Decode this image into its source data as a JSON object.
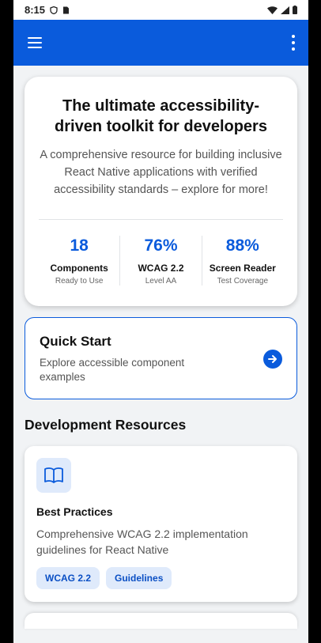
{
  "status_bar": {
    "time": "8:15"
  },
  "hero": {
    "title": "The ultimate accessibility-driven toolkit for developers",
    "description": "A comprehensive resource for building inclusive React Native applications with verified accessibility standards – explore for more!",
    "stats": [
      {
        "value": "18",
        "label": "Components",
        "sub": "Ready to Use"
      },
      {
        "value": "76%",
        "label": "WCAG 2.2",
        "sub": "Level AA"
      },
      {
        "value": "88%",
        "label": "Screen Reader",
        "sub": "Test Coverage"
      }
    ]
  },
  "quick_start": {
    "title": "Quick Start",
    "description": "Explore accessible component examples"
  },
  "resources": {
    "section_title": "Development Resources",
    "items": [
      {
        "icon": "book-icon",
        "title": "Best Practices",
        "description": "Comprehensive WCAG 2.2 implementation guidelines for React Native",
        "tags": [
          "WCAG 2.2",
          "Guidelines"
        ]
      }
    ]
  },
  "colors": {
    "primary": "#0a5bdc",
    "background": "#f1f3f5",
    "tag_bg": "#dfeafb"
  }
}
